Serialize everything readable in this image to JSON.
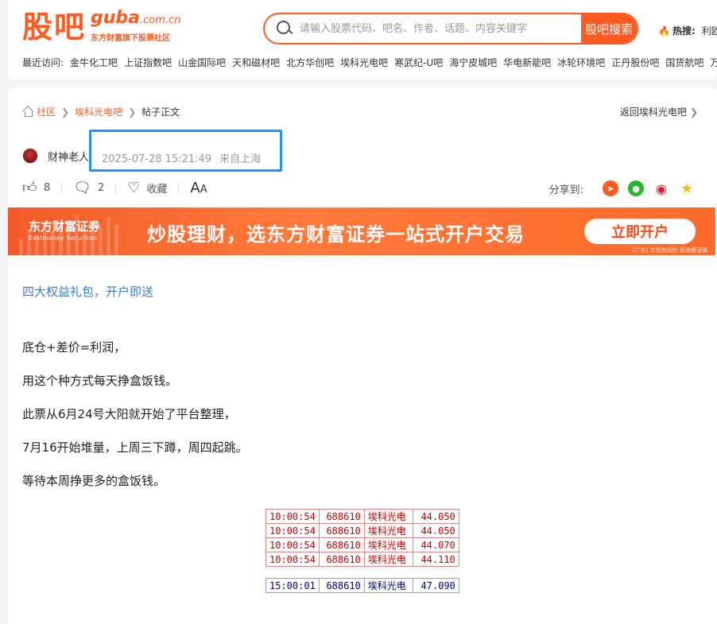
{
  "header": {
    "logo_cn": "股吧",
    "logo_en": "guba",
    "logo_domain": ".com.cn",
    "logo_sub": "东方财富旗下股票社区",
    "search_placeholder": "请输入股票代码、吧名、作者、话题、内容关键字",
    "search_button": "股吧搜索",
    "hot_label": "热搜:",
    "hot_value": "利欧",
    "recent_label": "最近访问:",
    "recent": [
      "金牛化工吧",
      "上证指数吧",
      "山金国际吧",
      "天和磁材吧",
      "北方华创吧",
      "埃科光电吧",
      "寒武纪-U吧",
      "海宁皮城吧",
      "华电新能吧",
      "冰轮环境吧",
      "正丹股份吧",
      "国货航吧",
      "万林"
    ]
  },
  "breadcrumb": {
    "home": "社区",
    "bar": "埃科光电吧",
    "current": "帖子正文",
    "back": "返回埃科光电吧"
  },
  "post": {
    "author": "财神老人",
    "time": "2025-07-28 15:21:49",
    "location": "来自上海",
    "likes": "8",
    "comments": "2",
    "favorite": "收藏",
    "share_label": "分享到:"
  },
  "banner": {
    "brand_cn": "东方财富证券",
    "brand_en": "Eastmoney Securities",
    "slogan": "炒股理财，选东方财富证券一站式开户交易",
    "button": "立即开户",
    "note": "[广告] 市场有风险 投资需谨慎"
  },
  "content": {
    "promo": "四大权益礼包，开户即送",
    "paragraphs": [
      "底仓+差价=利润，",
      "用这个种方式每天挣盒饭钱。",
      "此票从6月24号大阳就开始了平台整理，",
      "7月16开始堆量，上周三下蹲，周四起跳。",
      "等待本周挣更多的盒饭钱。"
    ],
    "buys": [
      [
        "10:00:54",
        "688610",
        "埃科光电",
        "44.050"
      ],
      [
        "10:00:54",
        "688610",
        "埃科光电",
        "44.050"
      ],
      [
        "10:00:54",
        "688610",
        "埃科光电",
        "44.070"
      ],
      [
        "10:00:54",
        "688610",
        "埃科光电",
        "44.110"
      ]
    ],
    "sells": [
      [
        "15:00:01",
        "688610",
        "埃科光电",
        "47.090"
      ]
    ]
  }
}
